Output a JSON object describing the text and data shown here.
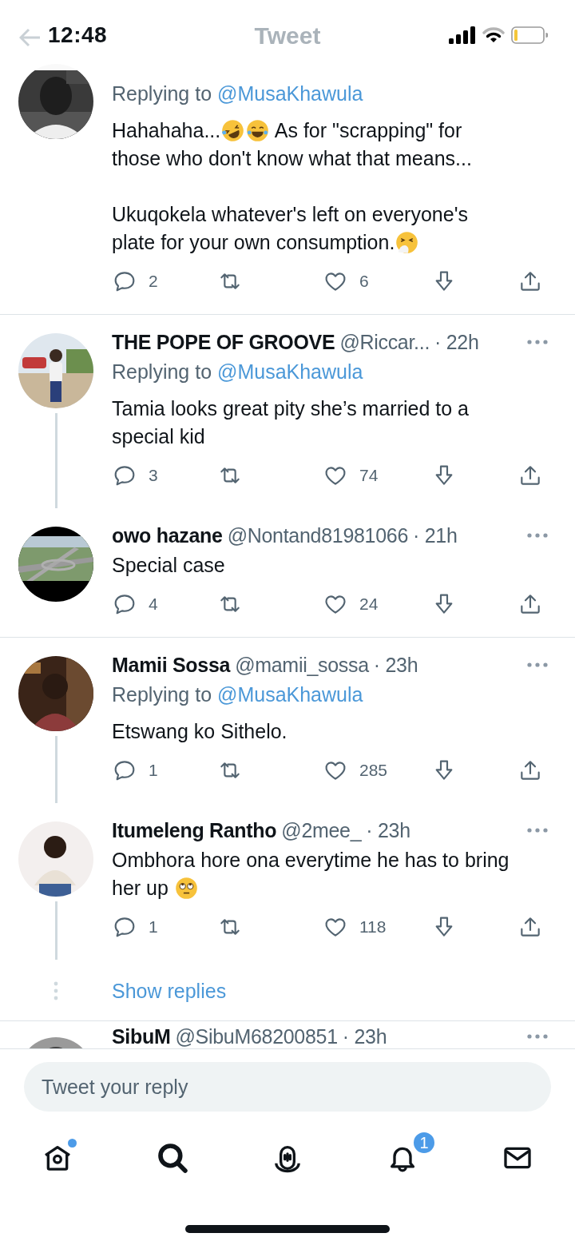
{
  "status_bar": {
    "time": "12:48"
  },
  "header": {
    "title": "Tweet"
  },
  "threads": [
    {
      "tweets": [
        {
          "replying_label": "Replying to",
          "replying_to": "@MusaKhawula",
          "paragraphs": [
            [
              [
                {
                  "kind": "text",
                  "text": "Hahahaha..."
                },
                {
                  "kind": "laugh"
                },
                {
                  "kind": "tears"
                },
                {
                  "kind": "text",
                  "text": " As for \"scrapping\" for"
                }
              ],
              "those who don't know what that means..."
            ],
            [
              "Ukuqokela whatever's left on everyone's",
              [
                {
                  "kind": "text",
                  "text": "plate for your own consumption."
                },
                {
                  "kind": "sneeze"
                }
              ]
            ]
          ],
          "replies": "2",
          "likes": "6"
        }
      ]
    },
    {
      "tweets": [
        {
          "name": "THE POPE OF GROOVE",
          "handle": "@Riccar...",
          "time": "· 22h",
          "replying_label": "Replying to",
          "replying_to": "@MusaKhawula",
          "paragraphs": [
            [
              "Tamia looks great pity she’s married to a",
              "special kid"
            ]
          ],
          "replies": "3",
          "likes": "74"
        },
        {
          "name": "owo hazane",
          "handle": "@Nontand81981066",
          "time": "· 21h",
          "paragraphs": [
            [
              "Special case"
            ]
          ],
          "replies": "4",
          "likes": "24"
        }
      ]
    },
    {
      "tweets": [
        {
          "name": "Mamii Sossa",
          "handle": "@mamii_sossa",
          "time": "· 23h",
          "replying_label": "Replying to",
          "replying_to": "@MusaKhawula",
          "paragraphs": [
            [
              "Etswang ko Sithelo."
            ]
          ],
          "replies": "1",
          "likes": "285"
        },
        {
          "name": "Itumeleng Rantho",
          "handle": "@2mee_",
          "time": "· 23h",
          "paragraphs": [
            [
              "Ombhora hore ona everytime he has to bring",
              [
                {
                  "kind": "text",
                  "text": "her up "
                },
                {
                  "kind": "eyeroll"
                }
              ]
            ]
          ],
          "replies": "1",
          "likes": "118"
        }
      ],
      "show_replies": "Show replies"
    },
    {
      "tweets": [
        {
          "name": "SibuM",
          "handle": "@SibuM68200851",
          "time": "· 23h"
        }
      ]
    }
  ],
  "composer": {
    "placeholder": "Tweet your reply"
  },
  "tabs": [
    {
      "kind": "home",
      "selected": false,
      "unread_dot": true
    },
    {
      "kind": "search",
      "selected": true,
      "unread_dot": false
    },
    {
      "kind": "spaces",
      "selected": false,
      "unread_dot": false
    },
    {
      "kind": "notifications",
      "selected": false,
      "unread_dot": false,
      "badge": "1"
    },
    {
      "kind": "messages",
      "selected": false,
      "unread_dot": false
    }
  ]
}
